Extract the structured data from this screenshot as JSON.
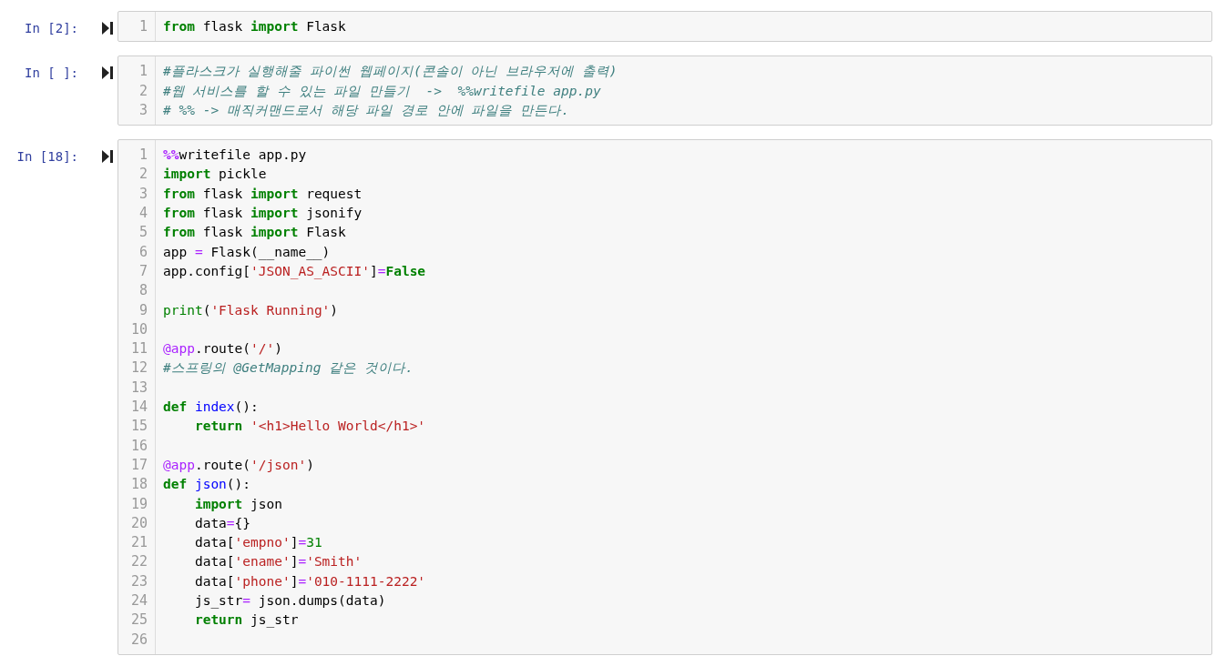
{
  "cells": [
    {
      "prompt": "In [2]:",
      "lines": [
        {
          "number": "1",
          "tokens": [
            {
              "kind": "kw",
              "text": "from"
            },
            {
              "kind": "plain",
              "text": " flask "
            },
            {
              "kind": "kw",
              "text": "import"
            },
            {
              "kind": "plain",
              "text": " Flask"
            }
          ]
        }
      ]
    },
    {
      "prompt": "In [ ]:",
      "lines": [
        {
          "number": "1",
          "tokens": [
            {
              "kind": "comment",
              "text": "#플라스크가 실행해줄 파이썬 웹페이지(콘솔이 아닌 브라우저에 출력)"
            }
          ]
        },
        {
          "number": "2",
          "tokens": [
            {
              "kind": "comment",
              "text": "#웹 서비스를 할 수 있는 파일 만들기  ->  %%writefile app.py"
            }
          ]
        },
        {
          "number": "3",
          "tokens": [
            {
              "kind": "comment",
              "text": "# %% -> 매직커맨드로서 해당 파일 경로 안에 파일을 만든다."
            }
          ]
        }
      ]
    },
    {
      "prompt": "In [18]:",
      "lines": [
        {
          "number": "1",
          "tokens": [
            {
              "kind": "magic",
              "text": "%%"
            },
            {
              "kind": "plain",
              "text": "writefile app.py"
            }
          ]
        },
        {
          "number": "2",
          "tokens": [
            {
              "kind": "kw",
              "text": "import"
            },
            {
              "kind": "plain",
              "text": " pickle"
            }
          ]
        },
        {
          "number": "3",
          "tokens": [
            {
              "kind": "kw",
              "text": "from"
            },
            {
              "kind": "plain",
              "text": " flask "
            },
            {
              "kind": "kw",
              "text": "import"
            },
            {
              "kind": "plain",
              "text": " request"
            }
          ]
        },
        {
          "number": "4",
          "tokens": [
            {
              "kind": "kw",
              "text": "from"
            },
            {
              "kind": "plain",
              "text": " flask "
            },
            {
              "kind": "kw",
              "text": "import"
            },
            {
              "kind": "plain",
              "text": " jsonify"
            }
          ]
        },
        {
          "number": "5",
          "tokens": [
            {
              "kind": "kw",
              "text": "from"
            },
            {
              "kind": "plain",
              "text": " flask "
            },
            {
              "kind": "kw",
              "text": "import"
            },
            {
              "kind": "plain",
              "text": " Flask"
            }
          ]
        },
        {
          "number": "6",
          "tokens": [
            {
              "kind": "plain",
              "text": "app "
            },
            {
              "kind": "op",
              "text": "="
            },
            {
              "kind": "plain",
              "text": " Flask(__name__)"
            }
          ]
        },
        {
          "number": "7",
          "tokens": [
            {
              "kind": "plain",
              "text": "app.config["
            },
            {
              "kind": "str",
              "text": "'JSON_AS_ASCII'"
            },
            {
              "kind": "plain",
              "text": "]"
            },
            {
              "kind": "op",
              "text": "="
            },
            {
              "kind": "kw",
              "text": "False"
            }
          ]
        },
        {
          "number": "8"
        },
        {
          "number": "9",
          "tokens": [
            {
              "kind": "builtin",
              "text": "print"
            },
            {
              "kind": "plain",
              "text": "("
            },
            {
              "kind": "str",
              "text": "'Flask Running'"
            },
            {
              "kind": "plain",
              "text": ")"
            }
          ]
        },
        {
          "number": "10"
        },
        {
          "number": "11",
          "tokens": [
            {
              "kind": "dec",
              "text": "@app"
            },
            {
              "kind": "plain",
              "text": ".route("
            },
            {
              "kind": "str",
              "text": "'/'"
            },
            {
              "kind": "plain",
              "text": ")"
            }
          ]
        },
        {
          "number": "12",
          "tokens": [
            {
              "kind": "comment",
              "text": "#스프링의 @GetMapping 같은 것이다."
            }
          ]
        },
        {
          "number": "13"
        },
        {
          "number": "14",
          "tokens": [
            {
              "kind": "kw",
              "text": "def"
            },
            {
              "kind": "fn",
              "text": " index"
            },
            {
              "kind": "plain",
              "text": "():"
            }
          ]
        },
        {
          "number": "15",
          "tokens": [
            {
              "kind": "kw",
              "text": "    return"
            },
            {
              "kind": "str",
              "text": " '<h1>Hello World</h1>'"
            }
          ]
        },
        {
          "number": "16"
        },
        {
          "number": "17",
          "tokens": [
            {
              "kind": "dec",
              "text": "@app"
            },
            {
              "kind": "plain",
              "text": ".route("
            },
            {
              "kind": "str",
              "text": "'/json'"
            },
            {
              "kind": "plain",
              "text": ")"
            }
          ]
        },
        {
          "number": "18",
          "tokens": [
            {
              "kind": "kw",
              "text": "def"
            },
            {
              "kind": "fn",
              "text": " json"
            },
            {
              "kind": "plain",
              "text": "():"
            }
          ]
        },
        {
          "number": "19",
          "tokens": [
            {
              "kind": "kw",
              "text": "    import"
            },
            {
              "kind": "plain",
              "text": " json"
            }
          ]
        },
        {
          "number": "20",
          "tokens": [
            {
              "kind": "plain",
              "text": "    data"
            },
            {
              "kind": "op",
              "text": "="
            },
            {
              "kind": "plain",
              "text": "{}"
            }
          ]
        },
        {
          "number": "21",
          "tokens": [
            {
              "kind": "plain",
              "text": "    data["
            },
            {
              "kind": "str",
              "text": "'empno'"
            },
            {
              "kind": "plain",
              "text": "]"
            },
            {
              "kind": "op",
              "text": "="
            },
            {
              "kind": "num",
              "text": "31"
            }
          ]
        },
        {
          "number": "22",
          "tokens": [
            {
              "kind": "plain",
              "text": "    data["
            },
            {
              "kind": "str",
              "text": "'ename'"
            },
            {
              "kind": "plain",
              "text": "]"
            },
            {
              "kind": "op",
              "text": "="
            },
            {
              "kind": "str",
              "text": "'Smith'"
            }
          ]
        },
        {
          "number": "23",
          "tokens": [
            {
              "kind": "plain",
              "text": "    data["
            },
            {
              "kind": "str",
              "text": "'phone'"
            },
            {
              "kind": "plain",
              "text": "]"
            },
            {
              "kind": "op",
              "text": "="
            },
            {
              "kind": "str",
              "text": "'010-1111-2222'"
            }
          ]
        },
        {
          "number": "24",
          "tokens": [
            {
              "kind": "plain",
              "text": "    js_str"
            },
            {
              "kind": "op",
              "text": "="
            },
            {
              "kind": "plain",
              "text": " json.dumps(data)"
            }
          ]
        },
        {
          "number": "25",
          "tokens": [
            {
              "kind": "kw",
              "text": "    return"
            },
            {
              "kind": "plain",
              "text": " js_str"
            }
          ]
        },
        {
          "number": "26"
        }
      ]
    }
  ]
}
